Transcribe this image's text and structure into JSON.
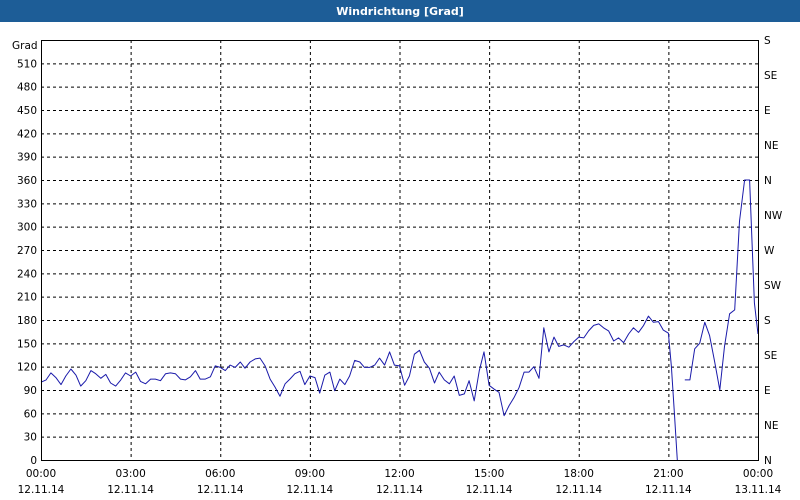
{
  "window": {
    "title": "Windrichtung [Grad]"
  },
  "colors": {
    "titlebar": "#1d5d97",
    "line": "#1a1aaa",
    "grid": "#000000"
  },
  "chart_data": {
    "type": "line",
    "title": "Windrichtung [Grad]",
    "ylabel": "Grad",
    "ylim": [
      0,
      540
    ],
    "yticks": [
      0,
      30,
      60,
      90,
      120,
      150,
      180,
      210,
      240,
      270,
      300,
      330,
      360,
      390,
      420,
      450,
      480,
      510
    ],
    "y2ticks": [
      {
        "value": 0,
        "label": "N"
      },
      {
        "value": 45,
        "label": "NE"
      },
      {
        "value": 90,
        "label": "E"
      },
      {
        "value": 135,
        "label": "SE"
      },
      {
        "value": 180,
        "label": "S"
      },
      {
        "value": 225,
        "label": "SW"
      },
      {
        "value": 270,
        "label": "W"
      },
      {
        "value": 315,
        "label": "NW"
      },
      {
        "value": 360,
        "label": "N"
      },
      {
        "value": 405,
        "label": "NE"
      },
      {
        "value": 450,
        "label": "E"
      },
      {
        "value": 495,
        "label": "SE"
      },
      {
        "value": 540,
        "label": "S"
      }
    ],
    "xlim": [
      0,
      24
    ],
    "xticks": [
      {
        "value": 0,
        "time": "00:00",
        "date": "12.11.14"
      },
      {
        "value": 3,
        "time": "03:00",
        "date": "12.11.14"
      },
      {
        "value": 6,
        "time": "06:00",
        "date": "12.11.14"
      },
      {
        "value": 9,
        "time": "09:00",
        "date": "12.11.14"
      },
      {
        "value": 12,
        "time": "12:00",
        "date": "12.11.14"
      },
      {
        "value": 15,
        "time": "15:00",
        "date": "12.11.14"
      },
      {
        "value": 18,
        "time": "18:00",
        "date": "12.11.14"
      },
      {
        "value": 21,
        "time": "21:00",
        "date": "12.11.14"
      },
      {
        "value": 24,
        "time": "00:00",
        "date": "13.11.14"
      }
    ],
    "grid": true,
    "series": [
      {
        "x": [
          0.0,
          0.17,
          0.33,
          0.5,
          0.67,
          0.83,
          1.0,
          1.17,
          1.33,
          1.5,
          1.67,
          1.83,
          2.0,
          2.17,
          2.33,
          2.5,
          2.67,
          2.83,
          3.0,
          3.17,
          3.33,
          3.5,
          3.67,
          3.83,
          4.0,
          4.17,
          4.33,
          4.5,
          4.67,
          4.83,
          5.0,
          5.17,
          5.33,
          5.5,
          5.67,
          5.83,
          6.0,
          6.17,
          6.33,
          6.5,
          6.67,
          6.83,
          7.0,
          7.17,
          7.33,
          7.5,
          7.67,
          7.83,
          8.0,
          8.17,
          8.33,
          8.5,
          8.67,
          8.83,
          9.0,
          9.17,
          9.33,
          9.5,
          9.67,
          9.83,
          10.0,
          10.17,
          10.33,
          10.5,
          10.67,
          10.83,
          11.0,
          11.17,
          11.33,
          11.5,
          11.67,
          11.83,
          12.0,
          12.17,
          12.33,
          12.5,
          12.67,
          12.83,
          13.0,
          13.17,
          13.33,
          13.5,
          13.67,
          13.83,
          14.0,
          14.17,
          14.33,
          14.5,
          14.67,
          14.83,
          15.0,
          15.17,
          15.33,
          15.5,
          15.67,
          15.83,
          16.0,
          16.17,
          16.33,
          16.5,
          16.67,
          16.83,
          17.0,
          17.17,
          17.33,
          17.5,
          17.67,
          17.83,
          18.0,
          18.17,
          18.33,
          18.5,
          18.67,
          18.83,
          19.0,
          19.17,
          19.33,
          19.5,
          19.67,
          19.83,
          20.0,
          20.17,
          20.33,
          20.5,
          20.67,
          20.83,
          21.0,
          21.1,
          21.2,
          21.3
        ],
        "y": [
          100,
          103,
          112,
          106,
          97,
          108,
          117,
          109,
          95,
          102,
          115,
          111,
          105,
          110,
          99,
          95,
          103,
          112,
          108,
          113,
          101,
          98,
          104,
          104,
          102,
          111,
          112,
          111,
          104,
          103,
          107,
          115,
          104,
          104,
          107,
          121,
          119,
          115,
          122,
          119,
          126,
          118,
          126,
          130,
          131,
          121,
          104,
          94,
          82,
          98,
          104,
          111,
          114,
          97,
          108,
          106,
          86,
          109,
          113,
          89,
          104,
          97,
          108,
          128,
          126,
          119,
          119,
          122,
          131,
          122,
          139,
          122,
          121,
          96,
          108,
          136,
          141,
          126,
          118,
          99,
          113,
          103,
          98,
          108,
          83,
          85,
          102,
          76,
          115,
          139,
          96,
          91,
          87,
          57,
          70,
          80,
          93,
          113,
          113,
          120,
          105,
          170,
          139,
          158,
          146,
          148,
          145,
          152,
          158,
          157,
          166,
          173,
          175,
          170,
          166,
          153,
          157,
          151,
          162,
          170,
          164,
          173,
          185,
          177,
          178,
          167,
          163,
          120,
          60,
          0
        ]
      },
      {
        "x": [
          21.55,
          21.72,
          21.88,
          22.05,
          22.22,
          22.38,
          22.55,
          22.72,
          22.88,
          23.05,
          23.22,
          23.38,
          23.55,
          23.72,
          23.88,
          24.0
        ],
        "y": [
          103,
          103,
          143,
          150,
          177,
          160,
          126,
          90,
          146,
          188,
          193,
          307,
          360,
          360,
          202,
          162
        ]
      }
    ]
  }
}
